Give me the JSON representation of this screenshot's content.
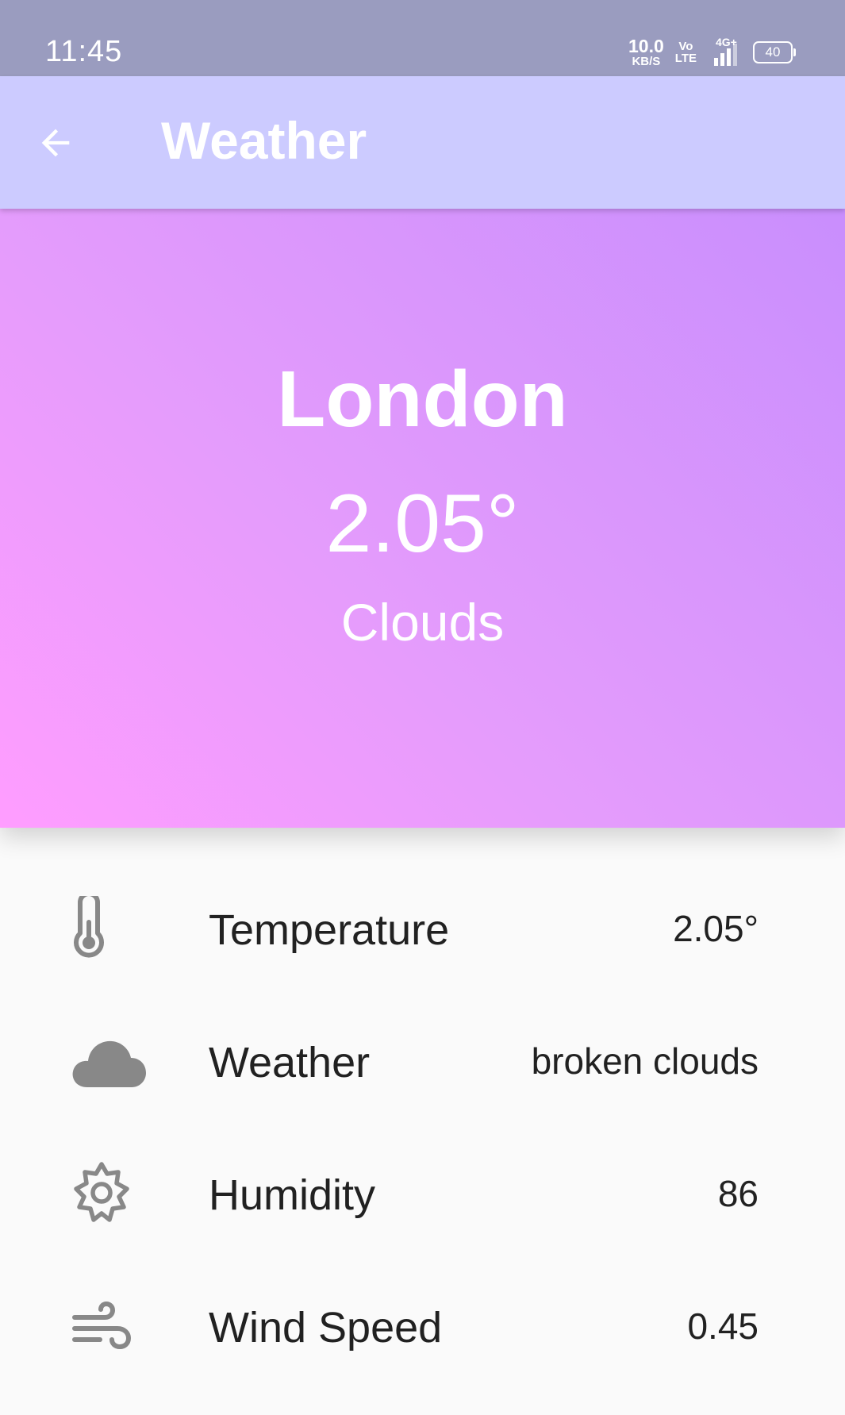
{
  "status_bar": {
    "time": "11:45",
    "net_speed_value": "10.0",
    "net_speed_unit": "KB/S",
    "volte_top": "Vo",
    "volte_bottom": "LTE",
    "network_type": "4G+",
    "battery": "40"
  },
  "app_bar": {
    "title": "Weather",
    "back_icon": "arrow-left-icon"
  },
  "hero": {
    "city": "London",
    "temperature": "2.05°",
    "condition": "Clouds",
    "gradient_colors": [
      "#ff9dff",
      "#e59cfc",
      "#c98efd"
    ]
  },
  "details": [
    {
      "icon": "thermometer-icon",
      "label": "Temperature",
      "value": "2.05°"
    },
    {
      "icon": "cloud-icon",
      "label": "Weather",
      "value": "broken clouds"
    },
    {
      "icon": "sun-icon",
      "label": "Humidity",
      "value": "86"
    },
    {
      "icon": "wind-icon",
      "label": "Wind Speed",
      "value": "0.45"
    }
  ],
  "colors": {
    "status_bar": "#9a9cbf",
    "app_bar": "#cccbff",
    "icon_gray": "#888888",
    "text_dark": "#212121",
    "background": "#fafafa"
  }
}
